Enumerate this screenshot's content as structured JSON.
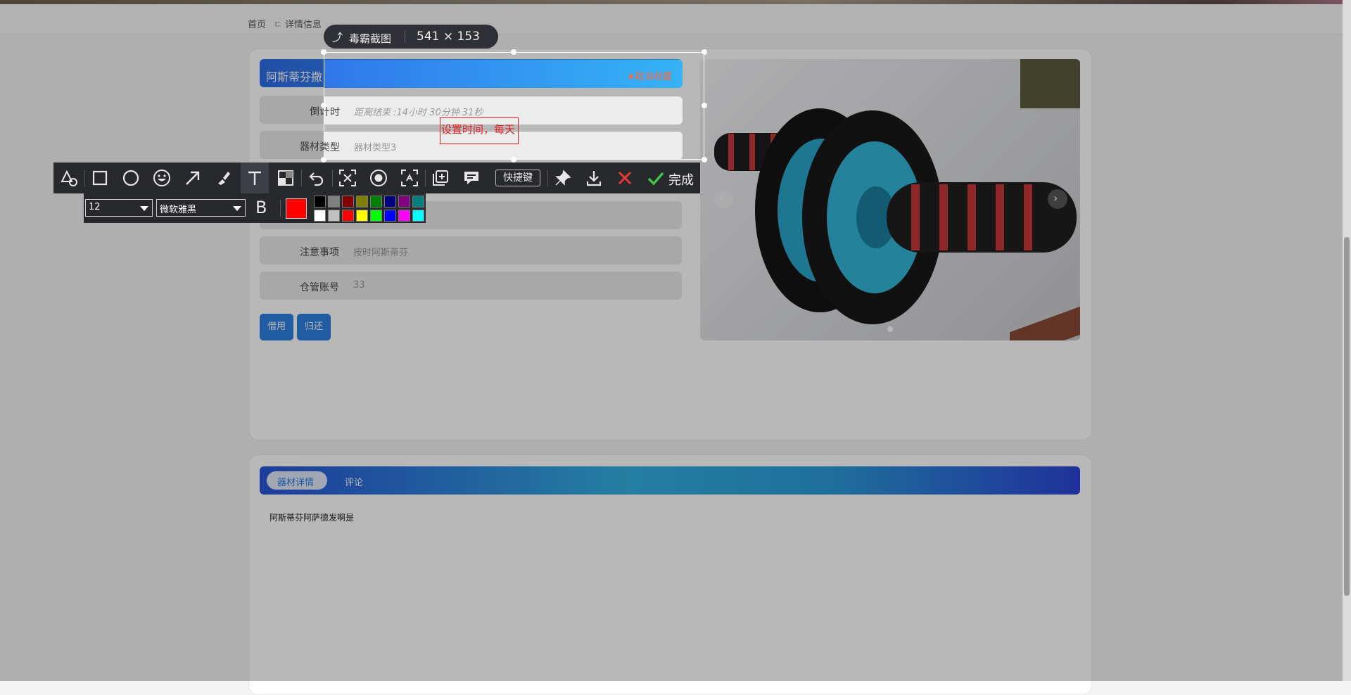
{
  "breadcrumb": {
    "home": "首页",
    "sep": "ㄷ",
    "current": "详情信息"
  },
  "product": {
    "title": "阿斯蒂芬撒",
    "favorite_label": "★取消收藏",
    "rows": [
      {
        "label": "倒计时",
        "value": "距离结束 :14小时 30分钟 31秒"
      },
      {
        "label": "器材类型",
        "value": "器材类型3"
      },
      {
        "label": "",
        "value": ""
      },
      {
        "label": "",
        "value": ""
      },
      {
        "label": "注意事项",
        "value": "按时阿斯蒂芬"
      },
      {
        "label": "仓管账号",
        "value": "33"
      }
    ],
    "borrow_label": "借用",
    "return_label": "归还"
  },
  "tabs": [
    {
      "label": "器材详情",
      "active": true
    },
    {
      "label": "评论",
      "active": false
    }
  ],
  "detail_text": "阿斯蒂芬阿萨德发啊是",
  "screenshot_tool": {
    "app_name": "毒霸截图",
    "selection_size": "541 × 153",
    "annotation_text": "设置时间，每天",
    "shortcut_label": "快捷键",
    "done_label": "完成",
    "font_size": "12",
    "font_name": "微软雅黑",
    "bold_label": "B",
    "current_color": "#ff0000",
    "palette_top": [
      "#000000",
      "#808080",
      "#800000",
      "#808000",
      "#008000",
      "#000080",
      "#800080",
      "#008080"
    ],
    "palette_bottom": [
      "#ffffff",
      "#c0c0c0",
      "#ff0000",
      "#ffff00",
      "#00ff00",
      "#0000ff",
      "#ff00ff",
      "#00ffff"
    ],
    "tools": [
      "shapes-icon",
      "rectangle-icon",
      "circle-icon",
      "emoji-icon",
      "arrow-icon",
      "pen-icon",
      "text-icon",
      "mosaic-icon",
      "undo-icon",
      "ocr-icon",
      "record-icon",
      "scroll-capture-icon",
      "pin-add-icon",
      "comment-icon"
    ]
  }
}
